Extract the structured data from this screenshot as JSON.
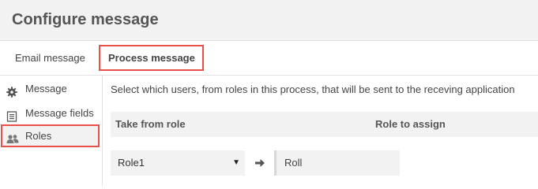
{
  "dialog": {
    "title": "Configure message"
  },
  "tabs": [
    {
      "label": "Email message",
      "active": false
    },
    {
      "label": "Process message",
      "active": true
    }
  ],
  "sidebar": {
    "items": [
      {
        "label": "Message",
        "icon": "gear-icon",
        "active": false
      },
      {
        "label": "Message fields",
        "icon": "list-icon",
        "active": false
      },
      {
        "label": "Roles",
        "icon": "users-icon",
        "active": true
      }
    ]
  },
  "main": {
    "description": "Select which users, from roles in this process, that will be sent to the receving application",
    "columns": {
      "take_from_role": "Take from role",
      "role_to_assign": "Role to assign"
    },
    "rows": [
      {
        "take_from_role": "Role1",
        "role_to_assign": "Roll"
      }
    ]
  },
  "colors": {
    "highlight": "#e9504a",
    "panel": "#f2f2f2",
    "text": "#444444"
  }
}
